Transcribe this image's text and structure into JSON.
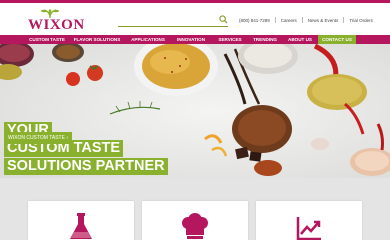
{
  "brand": {
    "name": "WIXON",
    "primary_color": "#b5175f",
    "accent_color": "#8ab12e"
  },
  "search": {
    "placeholder": "",
    "icon": "search-icon"
  },
  "utility_links": {
    "phone": "(800) 841-7289",
    "careers": "Careers",
    "news_events": "News & Events",
    "trial_orders": "Trial Orders"
  },
  "nav": {
    "items": [
      {
        "label": "CUSTOM TASTE"
      },
      {
        "label": "FLAVOR SOLUTIONS"
      },
      {
        "label": "APPLICATIONS"
      },
      {
        "label": "INNOVATION"
      },
      {
        "label": "SERVICES"
      },
      {
        "label": "TRENDING"
      },
      {
        "label": "ABOUT US"
      },
      {
        "label": "CONTACT US",
        "active": true
      }
    ]
  },
  "hero": {
    "headline": [
      "YOUR",
      "CUSTOM TASTE",
      "SOLUTIONS PARTNER"
    ],
    "cta_label": "WIXON CUSTOM TASTE"
  },
  "cards": [
    {
      "icon": "flask-icon"
    },
    {
      "icon": "chef-hat-icon"
    },
    {
      "icon": "chart-trend-icon"
    }
  ]
}
